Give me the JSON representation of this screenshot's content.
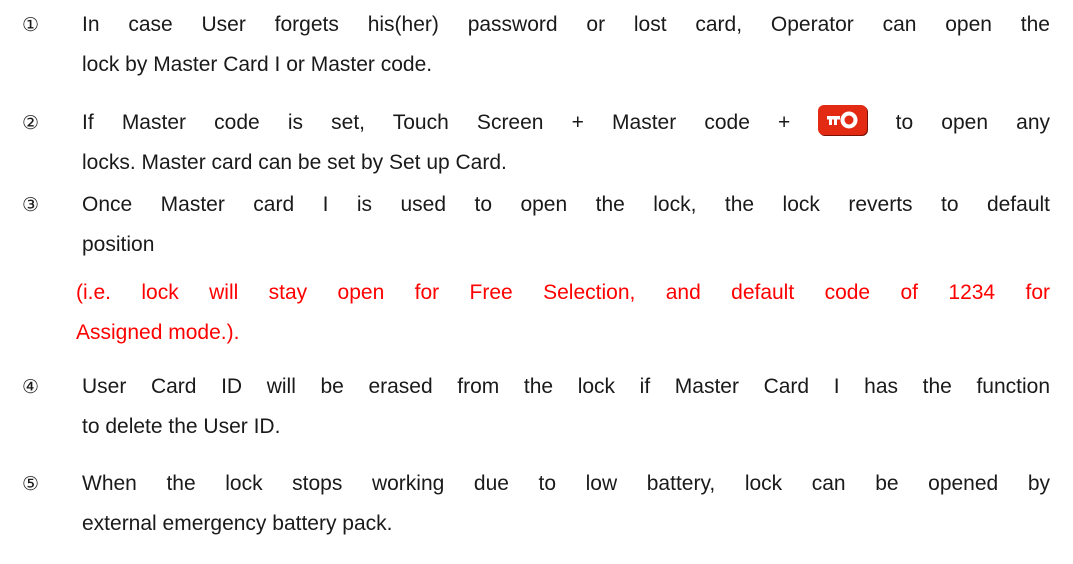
{
  "items": [
    {
      "marker": "①",
      "lines": [
        "In case User forgets his(her) password or lost card, Operator can open the",
        "lock by Master Card I or Master code."
      ]
    },
    {
      "marker": "②",
      "line1_before_icon": "If Master code is set, Touch Screen + Master code +",
      "line1_after_icon": "to open any",
      "line2": "locks. Master card can be set by Set up Card.",
      "icon": "key-icon",
      "icon_color": "#e32a12"
    },
    {
      "marker": "③",
      "lines": [
        "Once Master card I is used to open the lock, the lock reverts to default",
        "position"
      ],
      "note_lines": [
        "(i.e. lock will stay open for Free Selection, and default code of 1234 for",
        "Assigned mode.)."
      ],
      "note_color": "#ff0000"
    },
    {
      "marker": "④",
      "lines": [
        "User Card ID will be erased from the lock if Master Card I has the function",
        "to delete the User ID."
      ]
    },
    {
      "marker": "⑤",
      "lines": [
        "When the lock stops working due to low battery, lock can be opened by",
        "external emergency battery pack."
      ]
    }
  ]
}
